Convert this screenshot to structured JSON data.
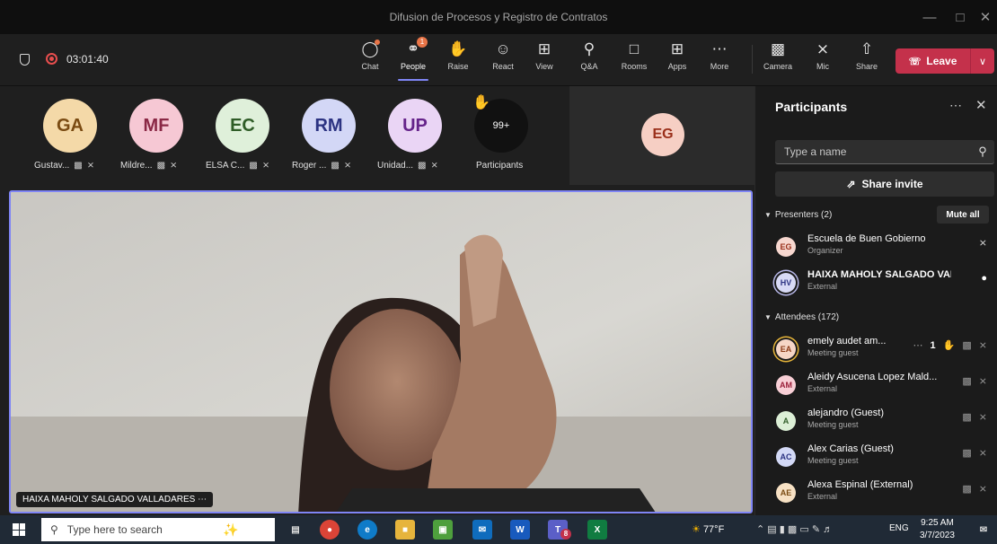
{
  "window": {
    "title": "Difusion de Procesos y Registro de Contratos"
  },
  "meeting": {
    "timer": "03:01:40"
  },
  "toolbar": {
    "chat": "Chat",
    "people": "People",
    "people_badge": "1",
    "raise": "Raise",
    "react": "React",
    "view": "View",
    "qa": "Q&A",
    "rooms": "Rooms",
    "apps": "Apps",
    "more": "More",
    "camera": "Camera",
    "mic": "Mic",
    "share": "Share",
    "leave": "Leave"
  },
  "participants_strip": [
    {
      "initials": "GA",
      "name": "Gustav...",
      "bg": "#f4d9a8",
      "fg": "#7a4b12"
    },
    {
      "initials": "MF",
      "name": "Mildre...",
      "bg": "#f6c8d4",
      "fg": "#8a2845"
    },
    {
      "initials": "EC",
      "name": "ELSA C...",
      "bg": "#dff0da",
      "fg": "#2f5c27"
    },
    {
      "initials": "RM",
      "name": "Roger ...",
      "bg": "#d3d7f6",
      "fg": "#2c3382"
    },
    {
      "initials": "UP",
      "name": "Unidad...",
      "bg": "#ead5f5",
      "fg": "#65238a"
    }
  ],
  "overflow": {
    "count": "99+",
    "label": "Participants"
  },
  "side_tile": {
    "initials": "EG"
  },
  "video": {
    "speaker": "HAIXA MAHOLY SALGADO VALLADARES"
  },
  "panel": {
    "title": "Participants",
    "search_placeholder": "Type a name",
    "share_invite": "Share invite",
    "mute_all": "Mute all",
    "presenters_header": "Presenters (2)",
    "attendees_header": "Attendees (172)",
    "presenters": [
      {
        "initials": "EG",
        "name": "Escuela de Buen Gobierno",
        "role": "Organizer",
        "bg": "#f7d7cf",
        "fg": "#9a2f1a"
      },
      {
        "initials": "HV",
        "name": "HAIXA MAHOLY SALGADO VAL...",
        "role": "External",
        "bg": "#d8daf5",
        "fg": "#2c3382"
      }
    ],
    "attendees": [
      {
        "initials": "EA",
        "name": "emely audet am...",
        "role": "Meeting guest",
        "raise_count": "1",
        "bg": "#f6d6c6",
        "fg": "#8a3a17"
      },
      {
        "initials": "AM",
        "name": "Aleidy Asucena Lopez Mald...",
        "role": "External",
        "bg": "#f8cfd6",
        "fg": "#9b1f3a"
      },
      {
        "initials": "A",
        "name": "alejandro (Guest)",
        "role": "Meeting guest",
        "bg": "#dcefd6",
        "fg": "#2f5c27"
      },
      {
        "initials": "AC",
        "name": "Alex Carias (Guest)",
        "role": "Meeting guest",
        "bg": "#d3d9f6",
        "fg": "#2c3382"
      },
      {
        "initials": "AE",
        "name": "Alexa Espinal (External)",
        "role": "External",
        "bg": "#f7e1c4",
        "fg": "#7a4b12"
      }
    ]
  },
  "taskbar": {
    "search_placeholder": "Type here to search",
    "weather": "77°F",
    "lang": "ENG",
    "time": "9:25 AM",
    "date": "3/7/2023",
    "teams_badge": "8"
  }
}
